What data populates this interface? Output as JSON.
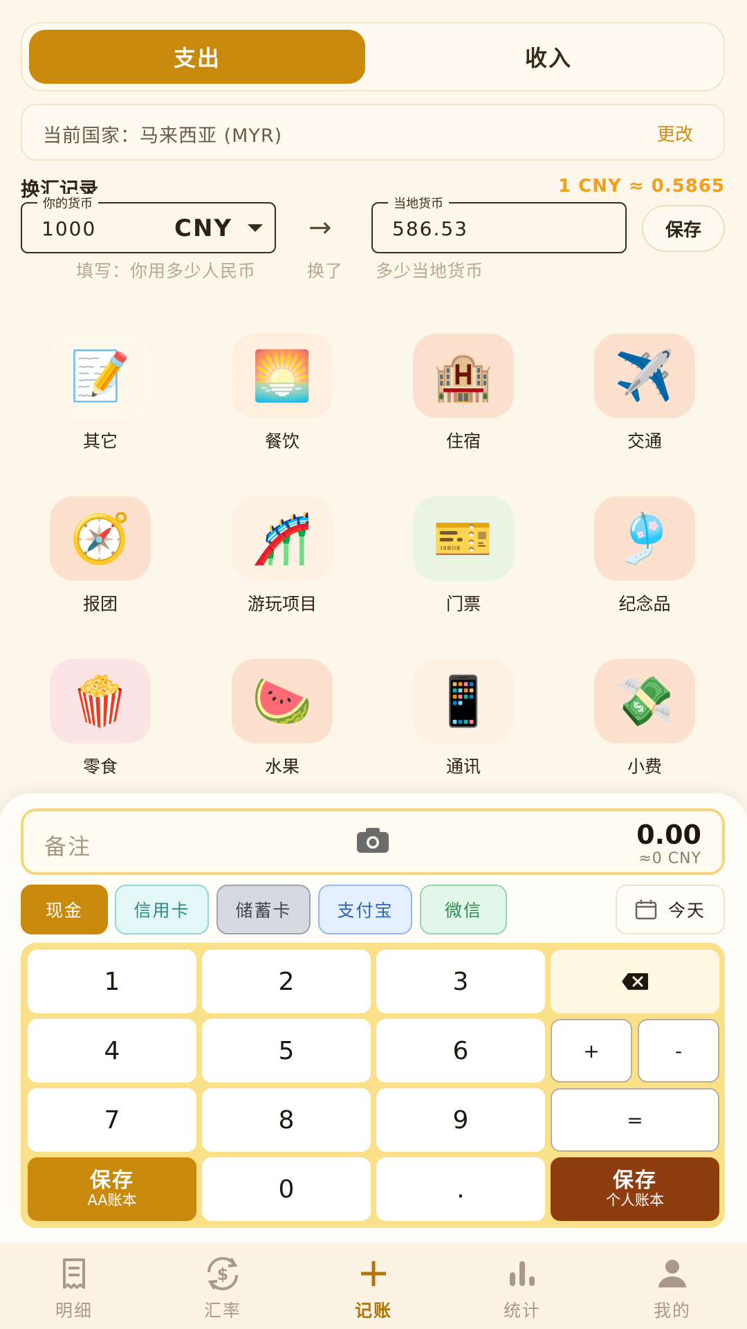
{
  "type_toggle": {
    "expense": "支出",
    "income": "收入"
  },
  "country": {
    "text": "当前国家：马来西亚 (MYR)",
    "change": "更改"
  },
  "exchange": {
    "title": "换汇记录",
    "rate": "1 CNY ≈ 0.5865",
    "your_currency_label": "你的货币",
    "your_amount": "1000",
    "your_currency": "CNY",
    "local_currency_label": "当地货币",
    "local_amount": "586.53",
    "save": "保存",
    "hint_1": "填写：你用多少人民币",
    "hint_2": "换了",
    "hint_3": "多少当地货币"
  },
  "categories": [
    {
      "label": "其它",
      "icon": "memo-icon",
      "glyph": "📝",
      "bg": "#fff8ec"
    },
    {
      "label": "餐饮",
      "icon": "day-night-icon",
      "glyph": "🌅",
      "bg": "#fdeedd"
    },
    {
      "label": "住宿",
      "icon": "hotel-icon",
      "glyph": "🏨",
      "bg": "#fde1cf"
    },
    {
      "label": "交通",
      "icon": "transport-icon",
      "glyph": "✈️",
      "bg": "#fde1cf"
    },
    {
      "label": "报团",
      "icon": "compass-icon",
      "glyph": "🧭",
      "bg": "#fde1cf"
    },
    {
      "label": "游玩项目",
      "icon": "roller-coaster-icon",
      "glyph": "🎢",
      "bg": "#fdf1e3"
    },
    {
      "label": "门票",
      "icon": "ticket-icon",
      "glyph": "🎫",
      "bg": "#eaf4e2"
    },
    {
      "label": "纪念品",
      "icon": "wind-chime-icon",
      "glyph": "🎐",
      "bg": "#fde1cf"
    },
    {
      "label": "零食",
      "icon": "popcorn-icon",
      "glyph": "🍿",
      "bg": "#fde4e4"
    },
    {
      "label": "水果",
      "icon": "watermelon-icon",
      "glyph": "🍉",
      "bg": "#fde1cf"
    },
    {
      "label": "通讯",
      "icon": "mobile-phone-icon",
      "glyph": "📱",
      "bg": "#fdf1e3"
    },
    {
      "label": "小费",
      "icon": "money-wings-icon",
      "glyph": "💸",
      "bg": "#fde1cf"
    }
  ],
  "entry": {
    "memo_placeholder": "备注",
    "amount": "0.00",
    "amount_cny": "≈0 CNY"
  },
  "payment": {
    "cash": "现金",
    "credit": "信用卡",
    "debit": "储蓄卡",
    "alipay": "支付宝",
    "wechat": "微信",
    "date": "今天"
  },
  "keypad": {
    "k1": "1",
    "k2": "2",
    "k3": "3",
    "k4": "4",
    "k5": "5",
    "k6": "6",
    "k7": "7",
    "k8": "8",
    "k9": "9",
    "k0": "0",
    "dot": ".",
    "plus": "+",
    "minus": "-",
    "equals": "=",
    "save_aa_1": "保存",
    "save_aa_2": "AA账本",
    "save_personal_1": "保存",
    "save_personal_2": "个人账本"
  },
  "nav": {
    "details": "明细",
    "rates": "汇率",
    "record": "记账",
    "stats": "统计",
    "me": "我的"
  },
  "colors": {
    "accent": "#c9890b",
    "personal": "#8e3d10",
    "keypad_bg": "#fbe08a"
  }
}
